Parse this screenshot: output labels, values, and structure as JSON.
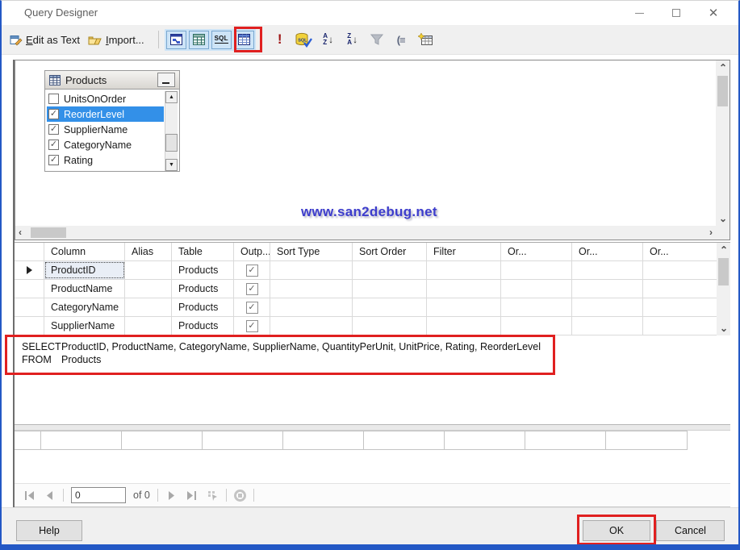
{
  "window": {
    "title": "Query Designer"
  },
  "window_controls": {
    "close_glyph": "✕"
  },
  "toolbar": {
    "edit_as_text": {
      "first": "E",
      "rest": "dit as Text"
    },
    "import": {
      "first": "I",
      "rest": "mport..."
    },
    "execute_glyph": "!",
    "sql_pane_icon_text": "SQL",
    "verify_sql_icon_text": "SQL",
    "sort_asc": {
      "top": "A",
      "bottom": "Z",
      "arrow": "↓"
    },
    "sort_desc": {
      "top": "Z",
      "bottom": "A",
      "arrow": "↓"
    },
    "groupby_glyph": "(≡"
  },
  "diagram": {
    "products": {
      "title": "Products",
      "fields": [
        {
          "label": "UnitsOnOrder",
          "check": ""
        },
        {
          "label": "ReorderLevel",
          "check": "✓"
        },
        {
          "label": "SupplierName",
          "check": "✓"
        },
        {
          "label": "CategoryName",
          "check": "✓"
        },
        {
          "label": "Rating",
          "check": "✓"
        }
      ]
    },
    "watermark": "www.san2debug.net"
  },
  "grid": {
    "headers": [
      "Column",
      "Alias",
      "Table",
      "Outp...",
      "Sort Type",
      "Sort Order",
      "Filter",
      "Or...",
      "Or...",
      "Or..."
    ],
    "rows": [
      {
        "column": "ProductID",
        "alias": "",
        "table": "Products",
        "output": "✓"
      },
      {
        "column": "ProductName",
        "alias": "",
        "table": "Products",
        "output": "✓"
      },
      {
        "column": "CategoryName",
        "alias": "",
        "table": "Products",
        "output": "✓"
      },
      {
        "column": "SupplierName",
        "alias": "",
        "table": "Products",
        "output": "✓"
      }
    ]
  },
  "sql": {
    "select_keyword": "SELECT",
    "select_list": "ProductID, ProductName, CategoryName, SupplierName, QuantityPerUnit, UnitPrice, Rating, ReorderLevel",
    "from_keyword": "FROM",
    "from_table": "Products"
  },
  "nav": {
    "record_value": "0",
    "of_label": "of 0"
  },
  "buttons": {
    "help": "Help",
    "ok": "OK",
    "cancel": "Cancel"
  },
  "colors": {
    "highlight_red": "#e02020",
    "selection_blue": "#3390e8",
    "watermark_blue": "#3d3dcc",
    "accent_border_blue": "#2358c5"
  }
}
